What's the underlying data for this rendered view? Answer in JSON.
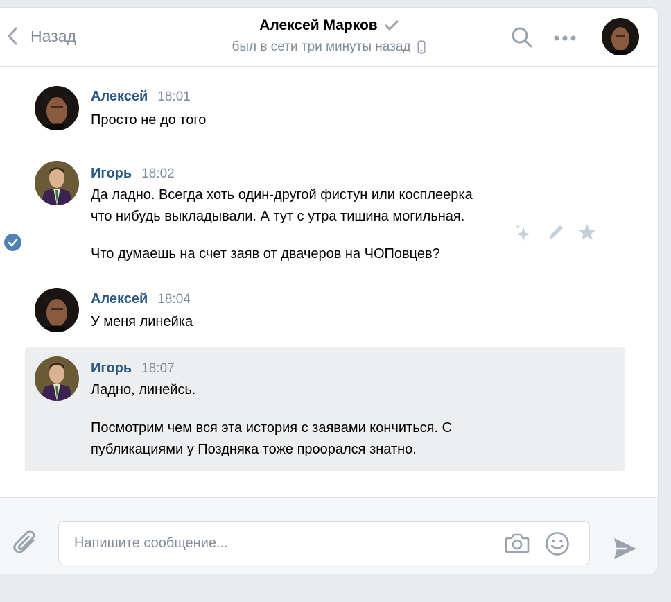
{
  "header": {
    "back_label": "Назад",
    "contact_name": "Алексей Марков",
    "status": "был в сети три минуты назад"
  },
  "messages": [
    {
      "author": "Алексей",
      "time": "18:01",
      "lines": [
        "Просто не до того"
      ]
    },
    {
      "author": "Игорь",
      "time": "18:02",
      "lines": [
        "Да ладно. Всегда хоть один-другой фистун или косплеерка",
        "что нибудь выкладывали. А тут с утра тишина могильная.",
        "",
        "Что думаешь на счет заяв от двачеров на ЧОПовцев?"
      ]
    },
    {
      "author": "Алексей",
      "time": "18:04",
      "lines": [
        "У меня линейка"
      ]
    },
    {
      "author": "Игорь",
      "time": "18:07",
      "lines": [
        "Ладно, линейсь.",
        "",
        "Посмотрим чем вся эта история с заявами кончиться. С",
        "публикациями у Поздняка тоже проорался знатно."
      ]
    }
  ],
  "composer": {
    "placeholder": "Напишите сообщение...",
    "value": ""
  },
  "icons": {
    "back": "chevron-left-icon",
    "verified": "checkmark-icon",
    "phone": "mobile-phone-icon",
    "search": "search-icon",
    "more": "more-dots-icon",
    "selected": "selected-check-icon",
    "ai": "sparkles-icon",
    "edit": "pencil-icon",
    "favorite": "star-icon",
    "attach": "paperclip-icon",
    "camera": "camera-icon",
    "emoji": "smile-icon",
    "send": "send-icon"
  },
  "colors": {
    "accent": "#2a5885",
    "muted": "#818c99",
    "check": "#5181b8"
  }
}
